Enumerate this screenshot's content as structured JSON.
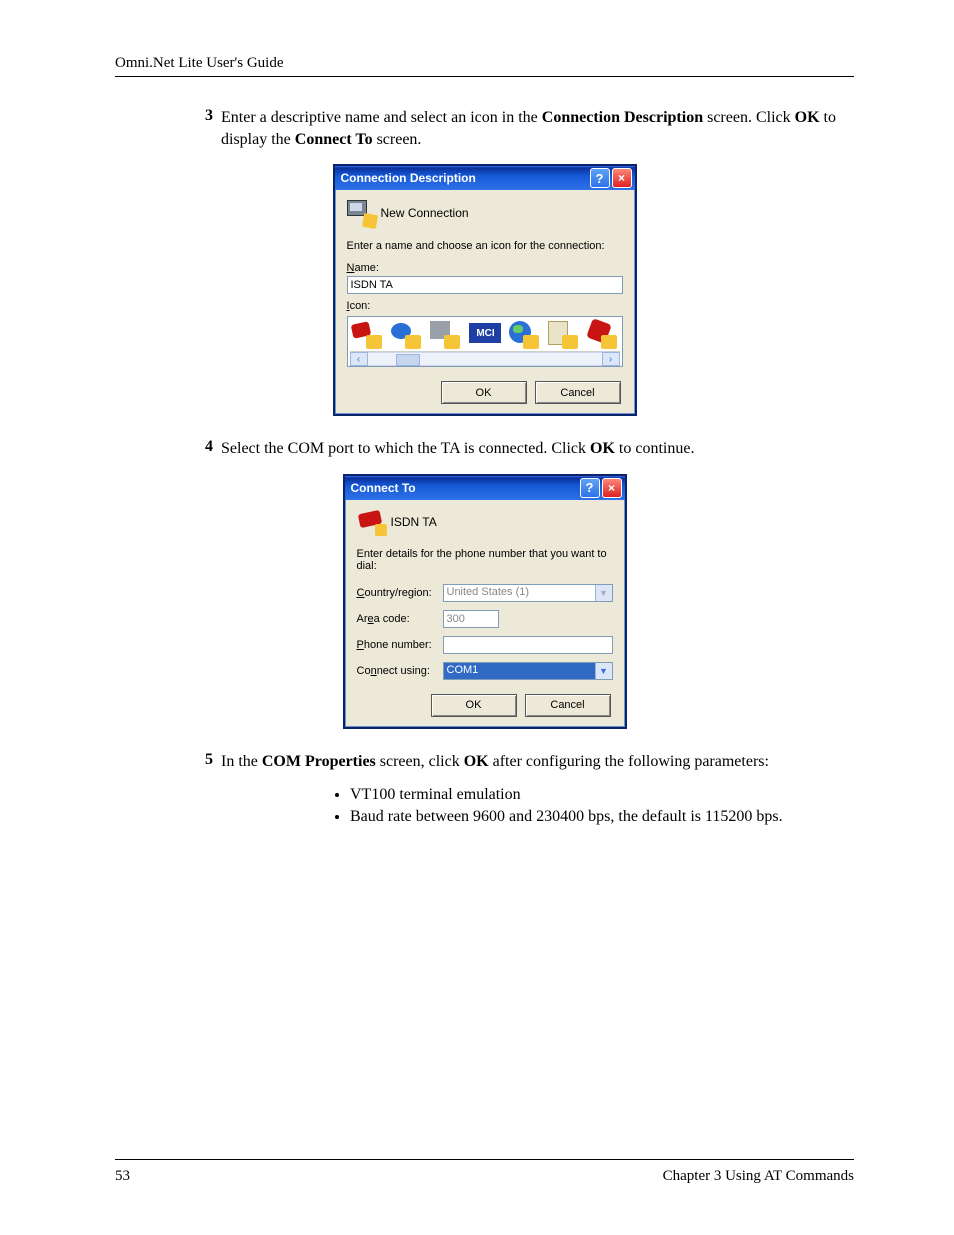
{
  "header": {
    "title": "Omni.Net Lite User's Guide"
  },
  "footer": {
    "page": "53",
    "chapter": "Chapter 3 Using AT Commands"
  },
  "steps": {
    "s3": {
      "num": "3",
      "text_a": "Enter a descriptive name and select an icon in the ",
      "bold_a": "Connection Description",
      "text_b": " screen. Click ",
      "bold_b": "OK",
      "text_c": " to display the ",
      "bold_c": "Connect To",
      "text_d": " screen."
    },
    "s4": {
      "num": "4",
      "text_a": "Select the COM port to which the TA is connected. Click ",
      "bold_a": "OK",
      "text_b": " to continue."
    },
    "s5": {
      "num": "5",
      "text_a": "In the ",
      "bold_a": "COM Properties",
      "text_b": " screen, click ",
      "bold_b": "OK",
      "text_c": " after configuring the following parameters:"
    }
  },
  "params": {
    "p1": "VT100 terminal emulation",
    "p2": "Baud rate between 9600 and 230400 bps, the default is 115200 bps."
  },
  "dialog1": {
    "title": "Connection Description",
    "heading": "New Connection",
    "instruction": "Enter a name and choose an icon for the connection:",
    "name_label_u": "N",
    "name_label_r": "ame:",
    "name_value": "ISDN TA",
    "icon_label_u": "I",
    "icon_label_r": "con:",
    "mci": "MCI",
    "ok": "OK",
    "cancel": "Cancel"
  },
  "dialog2": {
    "title": "Connect To",
    "heading": "ISDN TA",
    "instruction": "Enter details for the phone number that you want to dial:",
    "country_label_u": "C",
    "country_label_r": "ountry/region:",
    "country_value": "United States (1)",
    "area_label_a": "Ar",
    "area_label_u": "e",
    "area_label_b": "a code:",
    "area_value": "300",
    "phone_label_u": "P",
    "phone_label_r": "hone number:",
    "phone_value": "",
    "connect_label_a": "Co",
    "connect_label_u": "n",
    "connect_label_b": "nect using:",
    "connect_value": "COM1",
    "ok": "OK",
    "cancel": "Cancel"
  }
}
